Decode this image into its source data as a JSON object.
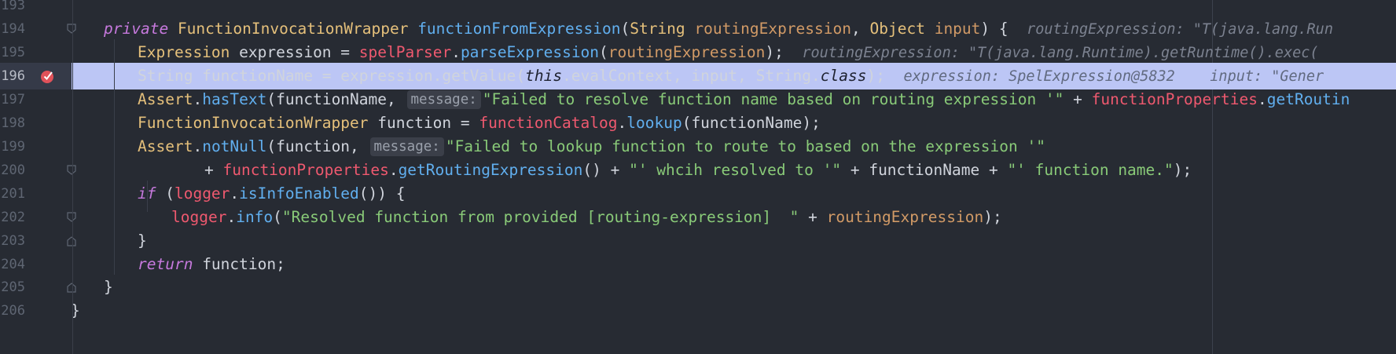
{
  "editor": {
    "lines": [
      {
        "num": "193"
      },
      {
        "num": "194",
        "parts": [
          {
            "t": "private",
            "c": "kw"
          },
          {
            "t": " ",
            "c": "plain"
          },
          {
            "t": "FunctionInvocationWrapper",
            "c": "type"
          },
          {
            "t": " ",
            "c": "plain"
          },
          {
            "t": "functionFromExpression",
            "c": "meth"
          },
          {
            "t": "(",
            "c": "plain"
          },
          {
            "t": "String",
            "c": "type"
          },
          {
            "t": " ",
            "c": "plain"
          },
          {
            "t": "routingExpression",
            "c": "param"
          },
          {
            "t": ", ",
            "c": "plain"
          },
          {
            "t": "Object",
            "c": "type"
          },
          {
            "t": " ",
            "c": "plain"
          },
          {
            "t": "input",
            "c": "param"
          },
          {
            "t": ") {",
            "c": "plain"
          }
        ],
        "inlay": "routingExpression: \"T(java.lang.Run"
      },
      {
        "num": "195",
        "parts": [
          {
            "t": "Expression",
            "c": "type"
          },
          {
            "t": " expression = ",
            "c": "plain"
          },
          {
            "t": "spelParser",
            "c": "field"
          },
          {
            "t": ".",
            "c": "plain"
          },
          {
            "t": "parseExpression",
            "c": "meth"
          },
          {
            "t": "(",
            "c": "plain"
          },
          {
            "t": "routingExpression",
            "c": "param"
          },
          {
            "t": ");",
            "c": "plain"
          }
        ],
        "inlay": "routingExpression: \"T(java.lang.Runtime).getRuntime().exec("
      },
      {
        "num": "196",
        "exec": true,
        "parts": [
          {
            "t": "String functionName = expression.getValue(",
            "c": "plain"
          },
          {
            "t": "this",
            "c": "it"
          },
          {
            "t": ".evalContext, input, String.",
            "c": "plain"
          },
          {
            "t": "class",
            "c": "it"
          },
          {
            "t": ");",
            "c": "plain"
          }
        ],
        "inlay": "expression: SpelExpression@5832    input: \"Gener"
      },
      {
        "num": "197",
        "parts": [
          {
            "t": "Assert",
            "c": "type"
          },
          {
            "t": ".",
            "c": "plain"
          },
          {
            "t": "hasText",
            "c": "meth"
          },
          {
            "t": "(functionName, ",
            "c": "plain"
          },
          {
            "t": "message:",
            "c": "hint"
          },
          {
            "t": "\"Failed to resolve function name based on routing expression '\"",
            "c": "str"
          },
          {
            "t": " + ",
            "c": "plain"
          },
          {
            "t": "functionProperties",
            "c": "field"
          },
          {
            "t": ".",
            "c": "plain"
          },
          {
            "t": "getRoutin",
            "c": "meth"
          }
        ]
      },
      {
        "num": "198",
        "parts": [
          {
            "t": "FunctionInvocationWrapper",
            "c": "type"
          },
          {
            "t": " function = ",
            "c": "plain"
          },
          {
            "t": "functionCatalog",
            "c": "field"
          },
          {
            "t": ".",
            "c": "plain"
          },
          {
            "t": "lookup",
            "c": "meth"
          },
          {
            "t": "(functionName);",
            "c": "plain"
          }
        ]
      },
      {
        "num": "199",
        "parts": [
          {
            "t": "Assert",
            "c": "type"
          },
          {
            "t": ".",
            "c": "plain"
          },
          {
            "t": "notNull",
            "c": "meth"
          },
          {
            "t": "(function, ",
            "c": "plain"
          },
          {
            "t": "message:",
            "c": "hint"
          },
          {
            "t": "\"Failed to lookup function to route to based on the expression '\"",
            "c": "str"
          }
        ]
      },
      {
        "num": "200",
        "parts": [
          {
            "t": "+ ",
            "c": "plain"
          },
          {
            "t": "functionProperties",
            "c": "field"
          },
          {
            "t": ".",
            "c": "plain"
          },
          {
            "t": "getRoutingExpression",
            "c": "meth"
          },
          {
            "t": "() + ",
            "c": "plain"
          },
          {
            "t": "\"' whcih resolved to '\"",
            "c": "str"
          },
          {
            "t": " + functionName + ",
            "c": "plain"
          },
          {
            "t": "\"' function name.\"",
            "c": "str"
          },
          {
            "t": ");",
            "c": "plain"
          }
        ]
      },
      {
        "num": "201",
        "parts": [
          {
            "t": "if",
            "c": "kw"
          },
          {
            "t": " (",
            "c": "plain"
          },
          {
            "t": "logger",
            "c": "field"
          },
          {
            "t": ".",
            "c": "plain"
          },
          {
            "t": "isInfoEnabled",
            "c": "meth"
          },
          {
            "t": "()) {",
            "c": "plain"
          }
        ]
      },
      {
        "num": "202",
        "parts": [
          {
            "t": "logger",
            "c": "field"
          },
          {
            "t": ".",
            "c": "plain"
          },
          {
            "t": "info",
            "c": "meth"
          },
          {
            "t": "(",
            "c": "plain"
          },
          {
            "t": "\"Resolved function from provided [routing-expression]  \"",
            "c": "str"
          },
          {
            "t": " + ",
            "c": "plain"
          },
          {
            "t": "routingExpression",
            "c": "param"
          },
          {
            "t": ");",
            "c": "plain"
          }
        ]
      },
      {
        "num": "203",
        "parts": [
          {
            "t": "}",
            "c": "plain"
          }
        ]
      },
      {
        "num": "204",
        "parts": [
          {
            "t": "return",
            "c": "kw"
          },
          {
            "t": " function;",
            "c": "plain"
          }
        ]
      },
      {
        "num": "205",
        "parts": [
          {
            "t": "}",
            "c": "plain"
          }
        ]
      },
      {
        "num": "206",
        "parts": [
          {
            "t": "}",
            "c": "plain"
          }
        ]
      }
    ]
  },
  "colors": {
    "background": "#272b33",
    "execution_line_highlight": "#bcc6f5",
    "breakpoint": "#e0525a",
    "keyword": "#c679dd",
    "type": "#e5c07b",
    "method": "#61afef",
    "field": "#ef596f",
    "parameter": "#d19a66",
    "string": "#89ca78"
  },
  "icons": {
    "breakpoint": "breakpoint-check-icon",
    "fold": "fold-marker-icon"
  }
}
